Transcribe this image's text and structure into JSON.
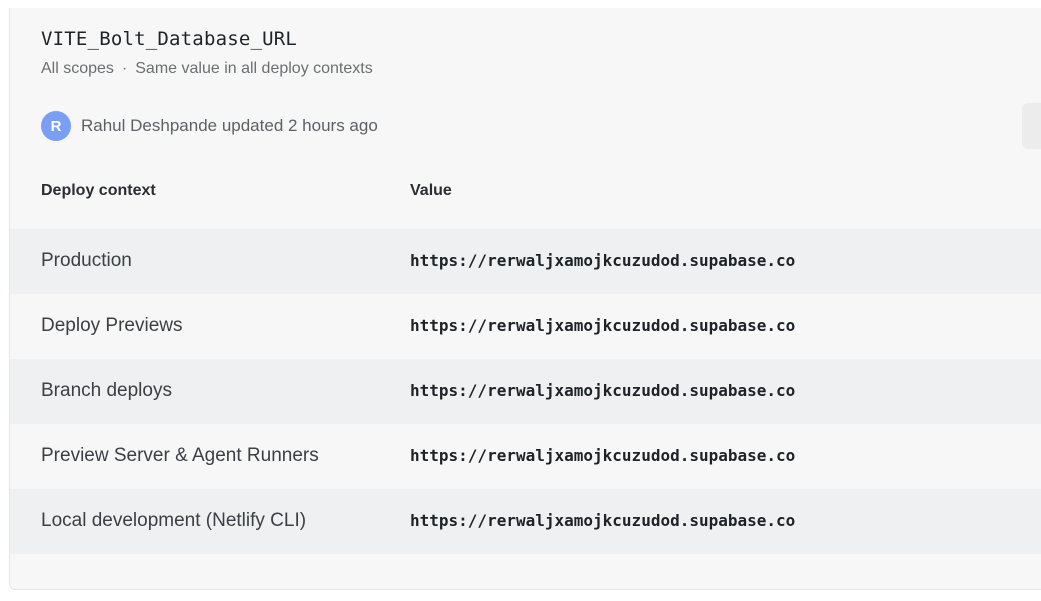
{
  "variable": {
    "name": "VITE_Bolt_Database_URL",
    "scopes": "All scopes",
    "separator": "·",
    "contexts_note": "Same value in all deploy contexts"
  },
  "update": {
    "avatar_initial": "R",
    "text": "Rahul Deshpande updated 2 hours ago"
  },
  "table": {
    "headers": {
      "context": "Deploy context",
      "value": "Value"
    },
    "rows": [
      {
        "context": "Production",
        "value": "https://rerwaljxamojkcuzudod.supabase.co"
      },
      {
        "context": "Deploy Previews",
        "value": "https://rerwaljxamojkcuzudod.supabase.co"
      },
      {
        "context": "Branch deploys",
        "value": "https://rerwaljxamojkcuzudod.supabase.co"
      },
      {
        "context": "Preview Server & Agent Runners",
        "value": "https://rerwaljxamojkcuzudod.supabase.co"
      },
      {
        "context": "Local development (Netlify CLI)",
        "value": "https://rerwaljxamojkcuzudod.supabase.co"
      }
    ]
  },
  "colors": {
    "avatar": "#7a9ef4",
    "card_background": "#f7f7f7",
    "row_stripe": "#eef0f1"
  }
}
